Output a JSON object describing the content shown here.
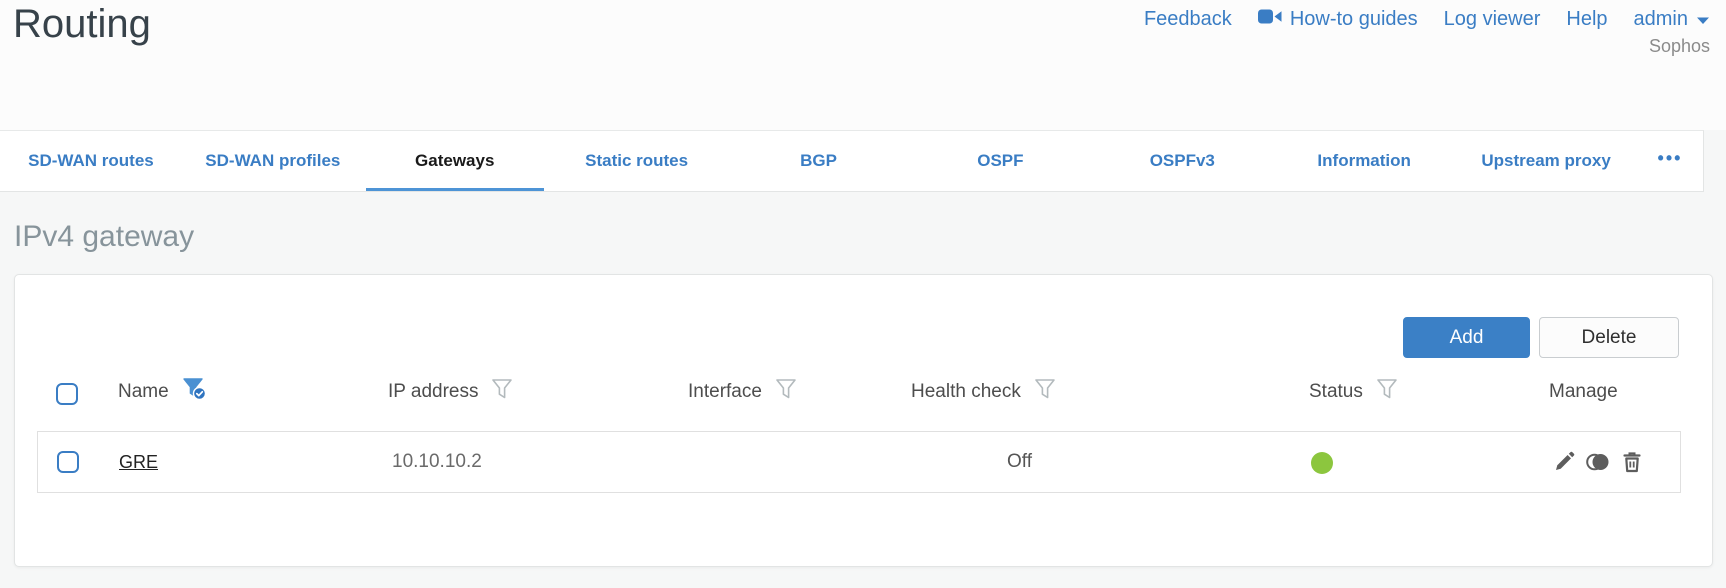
{
  "header": {
    "title": "Routing"
  },
  "topnav": {
    "feedback": "Feedback",
    "howto_guides": "How-to guides",
    "log_viewer": "Log viewer",
    "help": "Help",
    "user": "admin",
    "brand": "Sophos"
  },
  "tabs": [
    {
      "label": "SD-WAN routes",
      "active": false
    },
    {
      "label": "SD-WAN profiles",
      "active": false
    },
    {
      "label": "Gateways",
      "active": true
    },
    {
      "label": "Static routes",
      "active": false
    },
    {
      "label": "BGP",
      "active": false
    },
    {
      "label": "OSPF",
      "active": false
    },
    {
      "label": "OSPFv3",
      "active": false
    },
    {
      "label": "Information",
      "active": false
    },
    {
      "label": "Upstream proxy",
      "active": false
    },
    {
      "label": "•••",
      "active": false
    }
  ],
  "section": {
    "heading": "IPv4 gateway"
  },
  "toolbar": {
    "add_label": "Add",
    "delete_label": "Delete"
  },
  "table": {
    "columns": [
      {
        "label": "Name",
        "filter": "active"
      },
      {
        "label": "IP address",
        "filter": "inactive"
      },
      {
        "label": "Interface",
        "filter": "inactive"
      },
      {
        "label": "Health check",
        "filter": "inactive"
      },
      {
        "label": "Status",
        "filter": "inactive"
      },
      {
        "label": "Manage",
        "filter": "none"
      }
    ],
    "rows": [
      {
        "name": "GRE",
        "ip_address": "10.10.10.2",
        "interface": "",
        "health_check": "Off",
        "status": "green",
        "manage": [
          "edit",
          "clone",
          "delete"
        ]
      }
    ]
  },
  "icons": {
    "howto": "video-camera",
    "user_menu": "chevron-down",
    "column_filter": "funnel",
    "column_filter_active": "funnel-with-check",
    "manage_edit": "pencil",
    "manage_clone": "clone-circles",
    "manage_delete": "trash",
    "row_select": "checkbox",
    "status_up": "green-dot",
    "more_tabs": "ellipsis"
  },
  "colors": {
    "accent_blue": "#3a7dc4",
    "active_tab_underline": "#4d94d6",
    "add_button_bg": "#3b80c6",
    "status_green": "#8cc63e",
    "title_text": "#37424a",
    "section_heading_text": "#87949b"
  }
}
